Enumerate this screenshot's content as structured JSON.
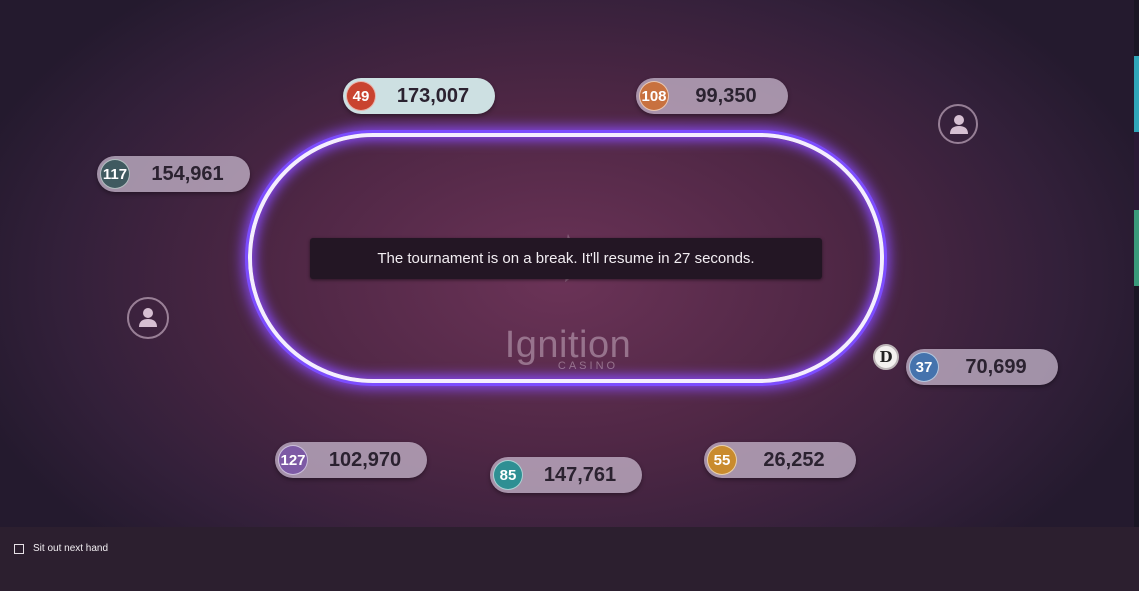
{
  "table": {
    "break_message": "The tournament is on a break. It'll resume in 27 seconds.",
    "logo": {
      "word": "Ignition",
      "sub": "CASINO"
    },
    "felt_rail_color": "#7c4dff"
  },
  "seats": [
    {
      "player_number": "49",
      "chip_stack": "173,007",
      "badge_color": "#c9432f",
      "active": true
    },
    {
      "player_number": "108",
      "chip_stack": "99,350",
      "badge_color": "#c8713f",
      "active": false
    },
    {
      "player_number": "117",
      "chip_stack": "154,961",
      "badge_color": "#3f5a60",
      "active": false
    },
    {
      "player_number": "37",
      "chip_stack": "70,699",
      "badge_color": "#4573ad",
      "active": false,
      "dealer": true
    },
    {
      "player_number": "127",
      "chip_stack": "102,970",
      "badge_color": "#7d5aa5",
      "active": false
    },
    {
      "player_number": "85",
      "chip_stack": "147,761",
      "badge_color": "#2e8f93",
      "active": false
    },
    {
      "player_number": "55",
      "chip_stack": "26,252",
      "badge_color": "#c98b2e",
      "active": false
    }
  ],
  "empty_seats": [
    {
      "icon": "person-icon"
    },
    {
      "icon": "person-icon"
    }
  ],
  "dealer_button": {
    "label": "D"
  },
  "controls": {
    "sit_out_next_hand": {
      "label": "Sit out next hand",
      "checked": false
    }
  },
  "side_strip_colors": [
    "#2fa6b8",
    "#2a1a35",
    "#3a9a7a"
  ]
}
